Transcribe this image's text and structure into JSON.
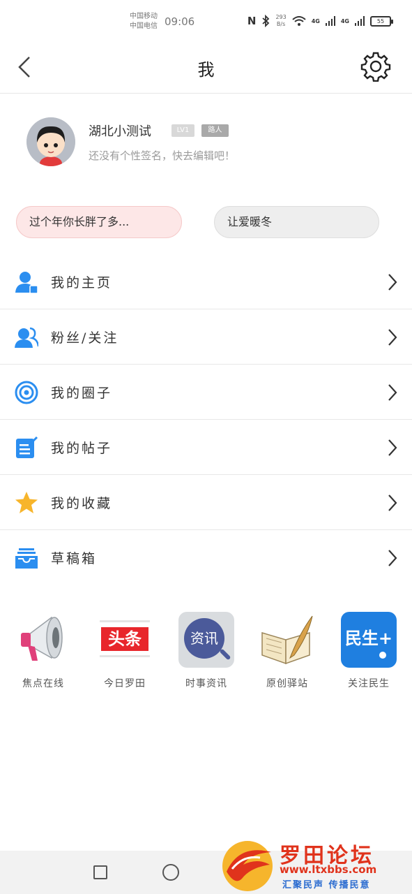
{
  "status_bar": {
    "carrier_1": "中国移动",
    "carrier_2": "中国电信",
    "time": "09:06",
    "speed_value": "293",
    "speed_unit": "B/s",
    "network_1": "4G",
    "network_2": "4G",
    "battery": "55"
  },
  "header": {
    "title": "我",
    "back_icon": "chevron-left-icon",
    "settings_icon": "gear-icon"
  },
  "profile": {
    "username": "湖北小测试",
    "level": "LV1",
    "role": "路人",
    "signature": "还没有个性签名，快去编辑吧！"
  },
  "pills": [
    {
      "label": "过个年你长胖了多..."
    },
    {
      "label": "让爱暖冬"
    }
  ],
  "menu": [
    {
      "label": "我的主页",
      "icon": "user-icon"
    },
    {
      "label": "粉丝/关注",
      "icon": "fans-icon"
    },
    {
      "label": "我的圈子",
      "icon": "circle-icon"
    },
    {
      "label": "我的帖子",
      "icon": "post-icon"
    },
    {
      "label": "我的收藏",
      "icon": "star-icon"
    },
    {
      "label": "草稿箱",
      "icon": "drafts-icon"
    }
  ],
  "apps": [
    {
      "label": "焦点在线",
      "icon": "megaphone-icon"
    },
    {
      "label": "今日罗田",
      "icon": "headline-icon",
      "icon_text": "头条"
    },
    {
      "label": "时事资讯",
      "icon": "news-icon",
      "icon_text": "资讯"
    },
    {
      "label": "原创驿站",
      "icon": "book-quill-icon"
    },
    {
      "label": "关注民生",
      "icon": "livelihood-icon",
      "icon_text": "民生+"
    }
  ],
  "watermark": {
    "title": "罗田论坛",
    "url": "www.ltxbbs.com",
    "slogan": "汇聚民声 传播民意"
  },
  "colors": {
    "accent_blue": "#2b8ef0",
    "star_yellow": "#f7b52c",
    "pill_pink": "#fde7e7",
    "brand_red": "#e0331c"
  }
}
